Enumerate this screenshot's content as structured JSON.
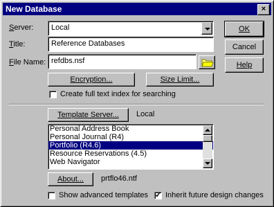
{
  "window": {
    "title": "New Database",
    "close_glyph": "×"
  },
  "server": {
    "label_first": "S",
    "label_rest": "erver:",
    "value": "Local"
  },
  "title_field": {
    "label_first": "T",
    "label_rest": "itle:",
    "value": "Reference Databases"
  },
  "filename": {
    "label_first": "F",
    "label_rest": "ile Name:",
    "value": "refdbs.nsf"
  },
  "buttons": {
    "ok": "OK",
    "cancel": "Cancel",
    "help": "Help",
    "encryption": "Encryption...",
    "size_limit": "Size Limit...",
    "template_server": "Template Server...",
    "about": "About..."
  },
  "fulltext": {
    "label": "Create full text index for searching",
    "checked": false
  },
  "template": {
    "server_value": "Local",
    "items": [
      "Personal Address Book",
      "Personal Journal (R4)",
      "Portfolio (R4.6)",
      "Resource Reservations (4.5)",
      "Web Navigator"
    ],
    "selected": "Portfolio (R4.6)",
    "file": "prtflo46.ntf"
  },
  "show_advanced": {
    "label": "Show advanced templates",
    "checked": false
  },
  "inherit": {
    "label": "Inherit future design changes",
    "checked": true,
    "mark": "✓"
  }
}
